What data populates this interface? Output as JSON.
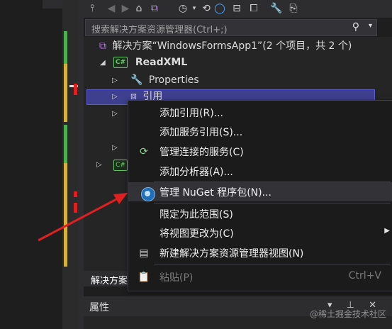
{
  "solution_explorer": {
    "search_placeholder": "搜索解决方案资源管理器(Ctrl+;)",
    "tree": {
      "solution": "解决方案“WindowsFormsApp1”(2 个项目，共 2 个)",
      "project": "ReadXML",
      "project_badge": "C#",
      "properties": "Properties",
      "references": "引用",
      "second_project_badge": "C#"
    },
    "bottom_tab": "解决方案",
    "properties_panel_title": "属性",
    "properties_panel_controls": "▾ ⊥ ✕"
  },
  "context_menu": {
    "items": [
      {
        "label": "添加引用(R)...",
        "icon": "none"
      },
      {
        "label": "添加服务引用(S)...",
        "icon": "none"
      },
      {
        "label": "管理连接的服务(C)",
        "icon": "connected-services-icon"
      },
      {
        "label": "添加分析器(A)...",
        "icon": "none"
      },
      {
        "label": "管理 NuGet 程序包(N)...",
        "icon": "nuget-icon"
      },
      {
        "label": "限定为此范围(S)",
        "icon": "none"
      },
      {
        "label": "将视图更改为(C)",
        "icon": "none",
        "submenu": "▶"
      },
      {
        "label": "新建解决方案资源管理器视图(N)",
        "icon": "new-view-icon"
      },
      {
        "label": "粘贴(P)",
        "icon": "paste-icon",
        "shortcut": "Ctrl+V",
        "disabled": true
      }
    ]
  },
  "watermark": "@稀土掘金技术社区",
  "colors": {
    "background": "#1e1e1e",
    "panel": "#252526",
    "selection": "#3f3f8f",
    "annotation_arrow": "#e02020",
    "git_added": "#4caf50",
    "git_modified": "#d4b23a"
  }
}
